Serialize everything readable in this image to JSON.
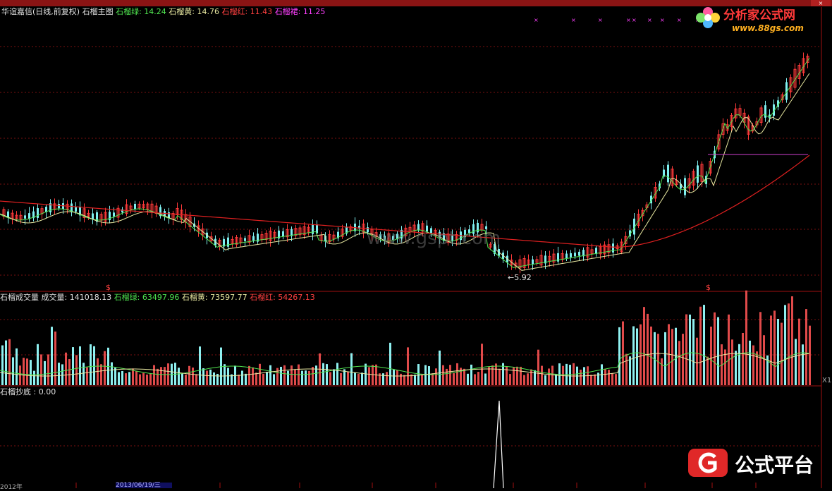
{
  "window": {
    "titlebar_color": "#8a1414",
    "close_icon": "close-icon"
  },
  "main_panel": {
    "stock_label": "华谊嘉信(日线,前复权) 石榴主图",
    "indicators": [
      {
        "label": "石榴绿: 14.24",
        "color": "#4fe34f"
      },
      {
        "label": "石榴黄: 14.76",
        "color": "#e8e8a0"
      },
      {
        "label": "石榴红: 11.43",
        "color": "#ff4040"
      },
      {
        "label": "石榴裙: 11.25",
        "color": "#ff40ff"
      }
    ],
    "low_marker": "←5.92",
    "dollar_mark": "$",
    "cross_mark": "×"
  },
  "volume_panel": {
    "title": "石榴成交量",
    "indicators": [
      {
        "label": "成交量: 141018.13",
        "color": "#e0e0e0"
      },
      {
        "label": "石榴绿: 63497.96",
        "color": "#4fe34f"
      },
      {
        "label": "石榴黄: 73597.77",
        "color": "#e8e8a0"
      },
      {
        "label": "石榴红: 54267.13",
        "color": "#ff4040"
      }
    ],
    "scale_label": "X1"
  },
  "bottom_panel": {
    "title": "石榴抄底 : 0.00"
  },
  "time_axis": {
    "selected_date": "2013/06/19/三",
    "first_label": "2012年"
  },
  "logos": {
    "top_brand": "分析家公式网",
    "top_url": "www.88gs.com",
    "bottom_brand": "公式平台",
    "watermark": "www.gspt.com"
  }
}
